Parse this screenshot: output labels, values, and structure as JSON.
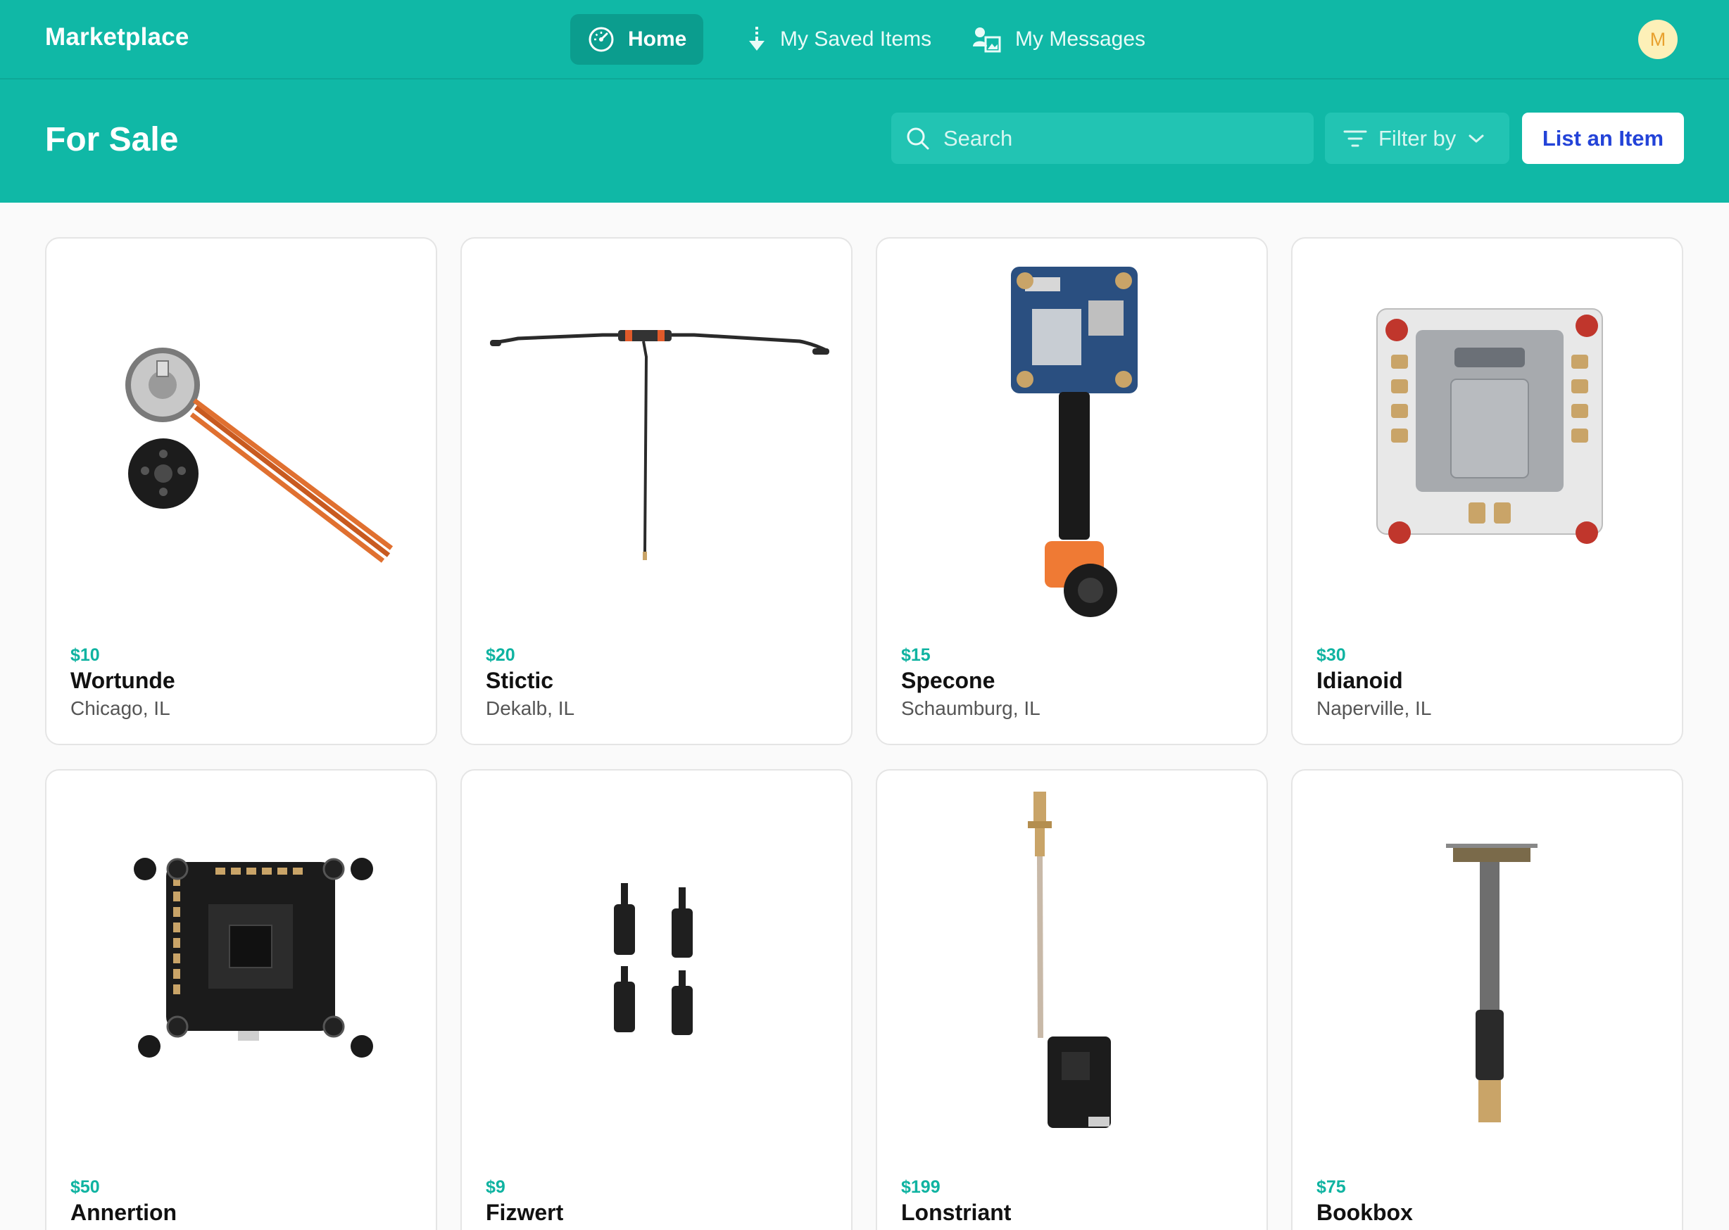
{
  "brand": "Marketplace",
  "nav": {
    "home": "Home",
    "saved": "My Saved Items",
    "messages": "My Messages"
  },
  "user": {
    "initial": "M"
  },
  "header": {
    "title": "For Sale",
    "search_placeholder": "Search",
    "filter_label": "Filter by",
    "list_button": "List an Item"
  },
  "colors": {
    "accent": "#10b8a6",
    "price": "#0fb3a1",
    "button_text": "#2343d8"
  },
  "listings": [
    {
      "price": "$10",
      "name": "Wortunde",
      "location": "Chicago, IL",
      "image": "brushless-motor"
    },
    {
      "price": "$20",
      "name": "Stictic",
      "location": "Dekalb, IL",
      "image": "t-antenna"
    },
    {
      "price": "$15",
      "name": "Specone",
      "location": "Schaumburg,  IL",
      "image": "fpv-camera"
    },
    {
      "price": "$30",
      "name": "Idianoid",
      "location": "Naperville, IL",
      "image": "esc-board"
    },
    {
      "price": "$50",
      "name": "Annertion",
      "location": "",
      "image": "flight-controller"
    },
    {
      "price": "$9",
      "name": "Fizwert",
      "location": "",
      "image": "standoffs"
    },
    {
      "price": "$199",
      "name": "Lonstriant",
      "location": "",
      "image": "video-transmitter"
    },
    {
      "price": "$75",
      "name": "Bookbox",
      "location": "",
      "image": "sma-antenna"
    }
  ]
}
